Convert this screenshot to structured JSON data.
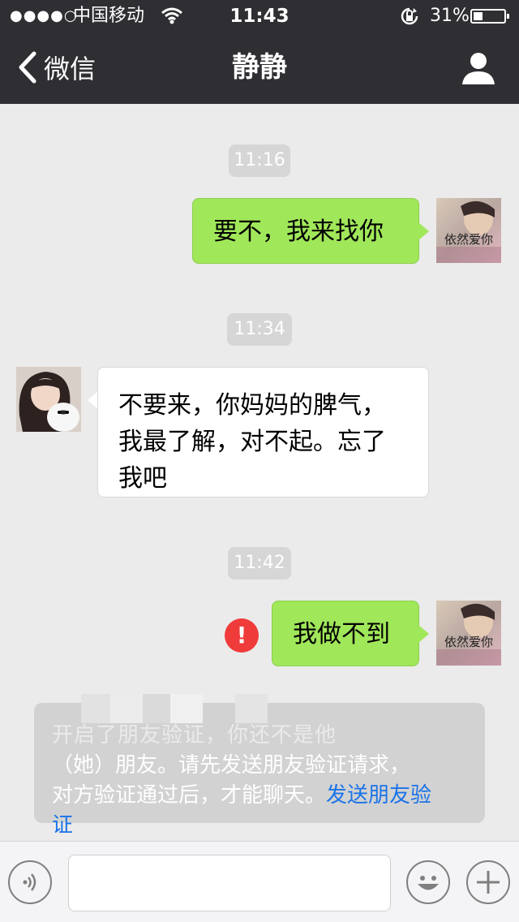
{
  "status_bar": {
    "signal_dots": "●●●●○",
    "carrier": "中国移动",
    "time": "11:43",
    "battery_percent": "31%",
    "battery_level": 0.31
  },
  "nav": {
    "back_label": "微信",
    "title": "静静"
  },
  "messages": [
    {
      "type": "time",
      "text": "11:16"
    },
    {
      "type": "message",
      "sender": "me",
      "text": "要不，我来找你",
      "avatar_caption": "依然爱你"
    },
    {
      "type": "time",
      "text": "11:34"
    },
    {
      "type": "message",
      "sender": "them",
      "lines": [
        "不要来，你妈妈的脾气，",
        "我最了解，对不起。忘了",
        "我吧"
      ]
    },
    {
      "type": "time",
      "text": "11:42"
    },
    {
      "type": "message",
      "sender": "me",
      "text": "我做不到",
      "status": "failed",
      "error_mark": "!",
      "avatar_caption": "依然爱你"
    }
  ],
  "system_notice": {
    "line1": "开启了朋友验证，你还不是他",
    "line2": "（她）朋友。请先发送朋友验证请求，",
    "line3": "对方验证通过后，才能聊天。",
    "link_part1": "发送朋友验",
    "link_part2": "证"
  },
  "input_bar": {
    "placeholder": ""
  },
  "colors": {
    "nav_bg": "#2f2f33",
    "chat_bg": "#ebebeb",
    "my_bubble": "#a0e75a",
    "their_bubble": "#ffffff",
    "error": "#f03b3b",
    "link": "#1a73e8"
  },
  "icons": {
    "back": "chevron-left-icon",
    "profile": "person-icon",
    "voice": "voice-icon",
    "emoji": "smiley-icon",
    "more": "plus-icon",
    "error": "exclamation-icon"
  }
}
